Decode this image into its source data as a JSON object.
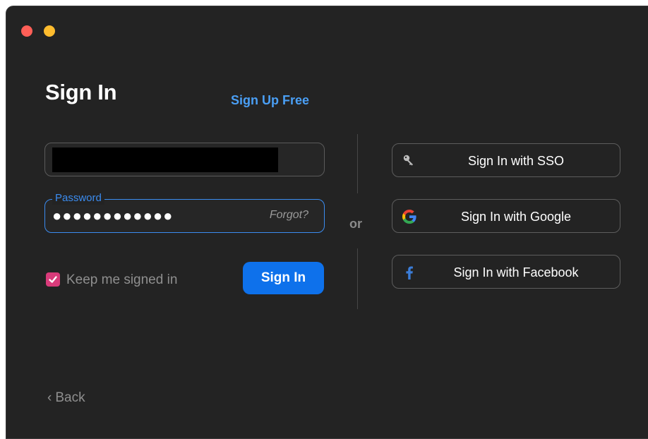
{
  "window": {
    "traffic_lights": [
      "close",
      "minimize"
    ]
  },
  "header": {
    "title": "Sign In",
    "signup_link": "Sign Up Free"
  },
  "form": {
    "email_value": "",
    "password_label": "Password",
    "password_masked": "●●●●●●●●●●●●",
    "forgot_link": "Forgot?",
    "keep_signed_in_label": "Keep me signed in",
    "keep_signed_in_checked": true,
    "signin_button": "Sign In"
  },
  "separator": {
    "or_label": "or"
  },
  "social": [
    {
      "label": "Sign In with SSO",
      "icon": "key-icon"
    },
    {
      "label": "Sign In with Google",
      "icon": "google-icon"
    },
    {
      "label": "Sign In with Facebook",
      "icon": "facebook-icon"
    }
  ],
  "footer": {
    "back_label": "Back"
  },
  "colors": {
    "background": "#232323",
    "accent": "#0e71eb",
    "link": "#4a9ff5",
    "checkbox": "#d93b7a"
  }
}
